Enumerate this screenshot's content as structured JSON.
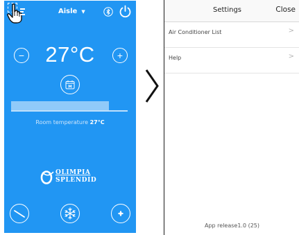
{
  "left_screen": {
    "room_name": "Aisle",
    "temperature": "27°C",
    "timer_icon_letter": "M",
    "room_temp_label": "Room temperature",
    "room_temp_value": "27°C",
    "room_temp_fraction": 0.84,
    "brand_line1": "OLIMPIA",
    "brand_line2": "SPLENDID",
    "icons": [
      "hand-pointer-icon",
      "menu-icon",
      "bluetooth-icon",
      "power-icon",
      "minus-icon",
      "plus-icon",
      "timer-icon",
      "mode-icon",
      "snowflake-icon",
      "fan-speed-icon"
    ],
    "colors": {
      "background": "#2196f3",
      "foreground": "#ffffff"
    }
  },
  "transition": {
    "icon": "chevron-right-icon"
  },
  "settings_screen": {
    "title": "Settings",
    "close_label": "Close",
    "items": [
      {
        "label": "Air Conditioner List"
      },
      {
        "label": "Help"
      }
    ],
    "row_chevron": ">",
    "footer": "App release1.0 (25)"
  }
}
